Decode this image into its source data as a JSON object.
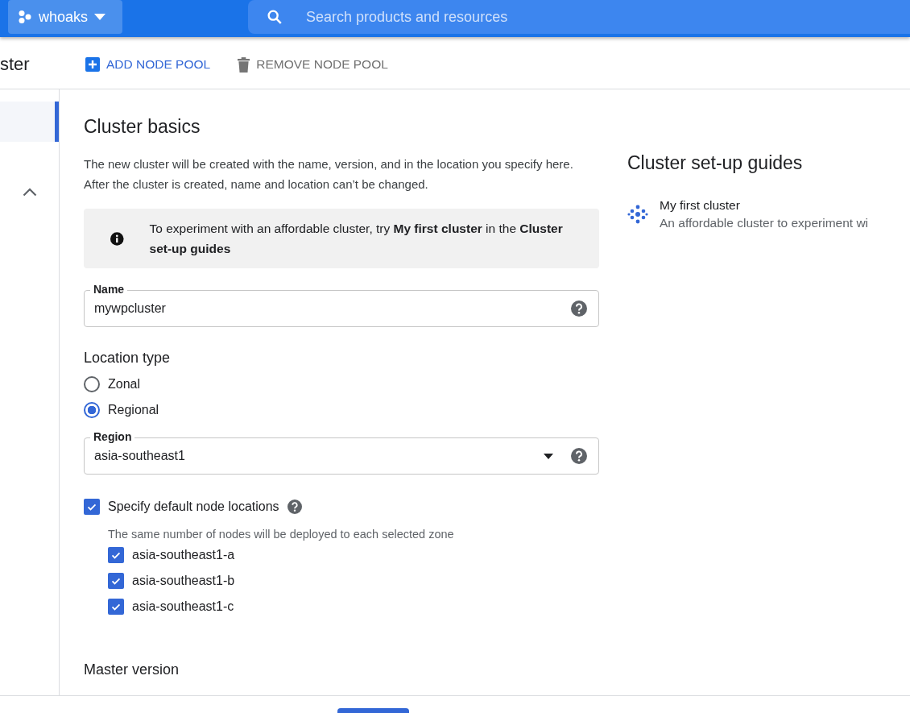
{
  "top_bar": {
    "project": "whoaks",
    "search": {
      "placeholder": "Search products and resources"
    }
  },
  "toolbar": {
    "title": "ster",
    "actions": [
      {
        "label": "ADD NODE POOL",
        "kind": "add",
        "disabled": false
      },
      {
        "label": "REMOVE NODE POOL",
        "kind": "remove",
        "disabled": true
      }
    ]
  },
  "sidebar": {
    "items": [
      {
        "selected": true
      }
    ],
    "group": {
      "expanded": true
    }
  },
  "form": {
    "heading": "Cluster basics",
    "description": "The new cluster will be created with the name, version, and in the location you specify here. After the cluster is created, name and location can’t be changed.",
    "note": "To experiment with an affordable cluster, try **My first cluster** in the **Cluster set-up guides**",
    "name_field": {
      "label": "Name",
      "value": "mywpcluster"
    },
    "location_type": {
      "heading": "Location type",
      "options": [
        {
          "label": "Zonal",
          "selected": false
        },
        {
          "label": "Regional",
          "selected": true
        }
      ]
    },
    "region_field": {
      "label": "Region",
      "value": "asia-southeast1"
    },
    "node_locations": {
      "label": "Specify default node locations",
      "checked": true,
      "hint": "The same number of nodes will be deployed to each selected zone",
      "zones": [
        {
          "label": "asia-southeast1-a",
          "checked": true
        },
        {
          "label": "asia-southeast1-b",
          "checked": true
        },
        {
          "label": "asia-southeast1-c",
          "checked": true
        }
      ]
    },
    "next_section": "Master version"
  },
  "guides": {
    "title": "Cluster set-up guides",
    "items": [
      {
        "title": "My first cluster",
        "description": "An affordable cluster to experiment wi"
      }
    ]
  }
}
